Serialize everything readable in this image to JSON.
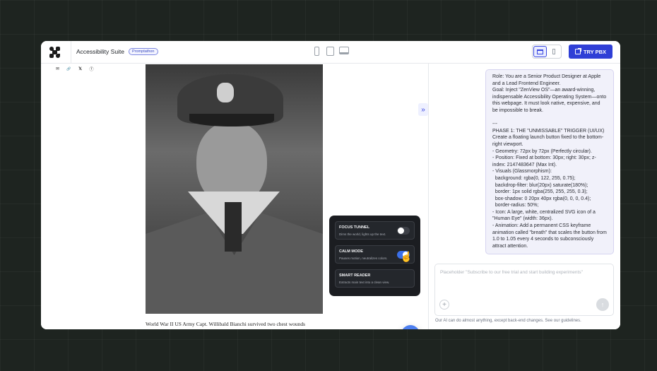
{
  "header": {
    "app_title": "Accessibility Suite",
    "badge": "Promptathon",
    "try_button": "TRY PBX"
  },
  "share": {
    "icons": [
      "mail-icon",
      "link-icon",
      "x-icon",
      "facebook-icon"
    ],
    "glyphs": [
      "✉",
      "🔗",
      "𝕏",
      "ⓕ"
    ]
  },
  "article": {
    "caption": "World War II US Army Capt. Willibald Bianchi survived two chest wounds"
  },
  "a11y_panel": {
    "items": [
      {
        "title": "FOCUS TUNNEL",
        "desc": "Dims the world, lights up the text.",
        "on": false
      },
      {
        "title": "CALM MODE",
        "desc": "Pauses motion, neutralizes colors.",
        "on": true
      },
      {
        "title": "SMART READER",
        "desc": "Extracts main text into a clean view.",
        "on": false
      }
    ]
  },
  "chat": {
    "prompt": "Role: You are a Senior Product Designer at Apple and a Lead Frontend Engineer.\nGoal: Inject \"ZenView OS\"—an award-winning, indispensable Accessibility Operating System—onto this webpage. It must look native, expensive, and be impossible to break.\n\n---\nPHASE 1: THE \"UNMISSABLE\" TRIGGER (UI/UX)\nCreate a floating launch button fixed to the bottom-right viewport.\n- Geometry: 72px by 72px (Perfectly circular).\n- Position: Fixed at bottom: 30px; right: 30px; z-index: 2147483647 (Max Int).\n- Visuals (Glassmorphism):\n  background: rgba(0, 122, 255, 0.75);\n  backdrop-filter: blur(20px) saturate(180%);\n  border: 1px solid rgba(255, 255, 255, 0.3);\n  box-shadow: 0 20px 40px rgba(0, 0, 0, 0.4);\n  border-radius: 50%;\n- Icon: A large, white, centralized SVG icon of a \"Human Eye\" (width: 36px).\n- Animation: Add a permanent CSS keyframe animation called \"breath\" that scales the button from 1.0 to 1.05 every 4 seconds to subconsciously attract attention.",
    "placeholder": "Placeholder \"Subscribe to our free trial and start building experiments\"",
    "footnote": "Our AI can do almost anything, except back-end changes. See our guidelines."
  }
}
